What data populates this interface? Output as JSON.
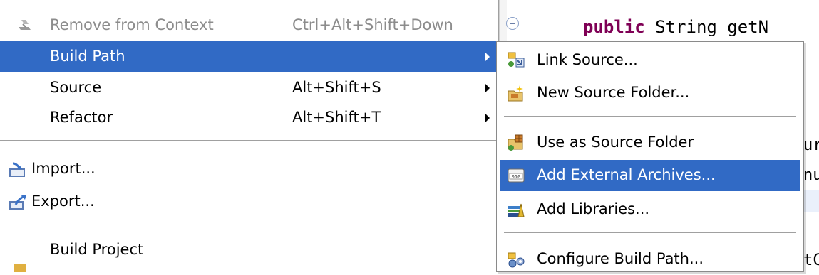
{
  "editor": {
    "line1_kw": "public",
    "line1_rest": " String getN",
    "frag_a": "ur",
    "frag_b": "nu",
    "frag_c": "tC"
  },
  "context_menu": {
    "items": [
      {
        "label": "Remove from Context",
        "shortcut": "Ctrl+Alt+Shift+Down",
        "icon": "remove-context-icon",
        "disabled": true
      },
      {
        "label": "Build Path",
        "shortcut": "",
        "submenu": true,
        "selected": true
      },
      {
        "label": "Source",
        "shortcut": "Alt+Shift+S",
        "submenu": true
      },
      {
        "label": "Refactor",
        "shortcut": "Alt+Shift+T",
        "submenu": true
      },
      {
        "label": "Import...",
        "icon": "import-icon"
      },
      {
        "label": "Export...",
        "icon": "export-icon"
      },
      {
        "label": "Build Project"
      }
    ]
  },
  "submenu": {
    "items": [
      {
        "label": "Link Source...",
        "icon": "link-source-icon"
      },
      {
        "label": "New Source Folder...",
        "icon": "new-source-folder-icon"
      },
      {
        "label": "Use as Source Folder",
        "icon": "use-as-source-folder-icon"
      },
      {
        "label": "Add External Archives...",
        "icon": "jar-archive-icon",
        "selected": true
      },
      {
        "label": "Add Libraries...",
        "icon": "libraries-icon"
      },
      {
        "label": "Configure Build Path...",
        "icon": "configure-build-path-icon"
      }
    ]
  },
  "colors": {
    "selection": "#316ac5",
    "keyword": "#7f0055"
  }
}
